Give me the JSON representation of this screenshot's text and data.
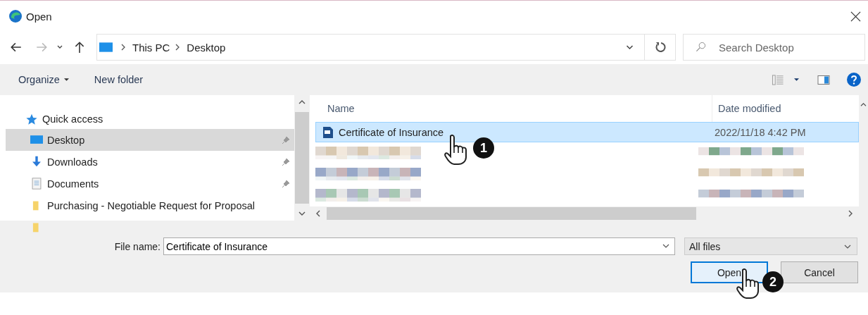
{
  "window": {
    "title": "Open"
  },
  "address": {
    "breadcrumbs": [
      "This PC",
      "Desktop"
    ]
  },
  "search": {
    "placeholder": "Search Desktop"
  },
  "toolbar": {
    "buttons": [
      "Organize",
      "New folder"
    ]
  },
  "sidebar": {
    "items": [
      {
        "kind": "star",
        "label": "Quick access",
        "selected": false,
        "pinned": false
      },
      {
        "kind": "desktop",
        "label": "Desktop",
        "selected": true,
        "pinned": true
      },
      {
        "kind": "download",
        "label": "Downloads",
        "selected": false,
        "pinned": true
      },
      {
        "kind": "document",
        "label": "Documents",
        "selected": false,
        "pinned": true
      },
      {
        "kind": "folder",
        "label": "Purchasing - Negotiable Request for Proposal",
        "selected": false,
        "pinned": false
      },
      {
        "kind": "folder",
        "selected": false,
        "pinned": false
      }
    ]
  },
  "file_list": {
    "columns": [
      "Name",
      "Date modified"
    ],
    "rows": [
      {
        "kind": "file",
        "name": "Certificate of Insurance",
        "date": "2022/11/18 4:42 PM",
        "selected": true
      },
      {
        "kind": "pixelated",
        "selected": false
      },
      {
        "kind": "pixelated",
        "selected": false
      },
      {
        "kind": "pixelated",
        "selected": false
      }
    ]
  },
  "file_name": {
    "label": "File name:",
    "value": "Certificate of Insurance"
  },
  "file_type": {
    "value": "All files"
  },
  "buttons": [
    {
      "label": "Open",
      "focused": true
    },
    {
      "label": "Cancel",
      "focused": false
    }
  ],
  "annotations": [
    {
      "number": "1"
    },
    {
      "number": "2"
    }
  ]
}
